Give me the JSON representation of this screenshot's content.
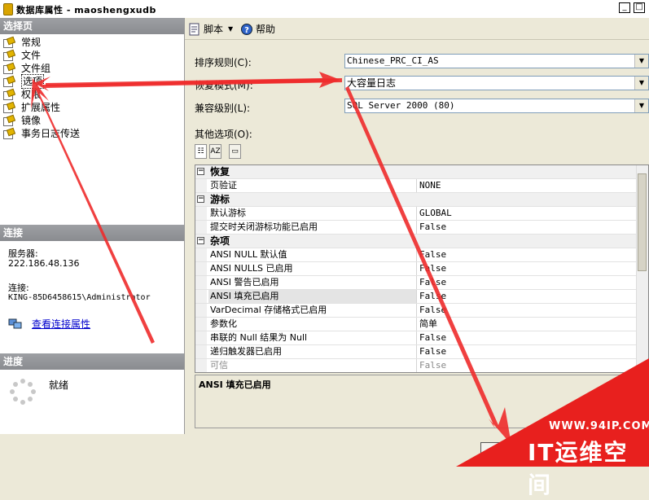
{
  "window": {
    "title": "数据库属性 - maoshengxudb"
  },
  "left": {
    "select_page_header": "选择页",
    "nav_items": [
      "常规",
      "文件",
      "文件组",
      "选项",
      "权限",
      "扩展属性",
      "镜像",
      "事务日志传送"
    ],
    "selected_index": 3,
    "connection_header": "连接",
    "server_label": "服务器:",
    "server_value": "222.186.48.136",
    "connection_label": "连接:",
    "connection_value": "KING-85D6458615\\Administrator",
    "view_conn_link": "查看连接属性",
    "progress_header": "进度",
    "progress_status": "就绪"
  },
  "toolbar": {
    "script_label": "脚本",
    "help_label": "帮助"
  },
  "form": {
    "collation_label": "排序规则(C):",
    "collation_value": "Chinese_PRC_CI_AS",
    "recovery_label": "恢复模式(M):",
    "recovery_value": "大容量日志",
    "compat_label": "兼容级别(L):",
    "compat_value": "SQL Server 2000 (80)",
    "other_options_label": "其他选项(O):"
  },
  "grid": {
    "rows": [
      {
        "type": "cat",
        "name": "恢复"
      },
      {
        "name": "页验证",
        "value": "NONE"
      },
      {
        "type": "cat",
        "name": "游标"
      },
      {
        "name": "默认游标",
        "value": "GLOBAL"
      },
      {
        "name": "提交时关闭游标功能已启用",
        "value": "False"
      },
      {
        "type": "cat",
        "name": "杂项"
      },
      {
        "name": "ANSI NULL 默认值",
        "value": "False"
      },
      {
        "name": "ANSI NULLS 已启用",
        "value": "False"
      },
      {
        "name": "ANSI 警告已启用",
        "value": "False"
      },
      {
        "name": "ANSI 填充已启用",
        "value": "False",
        "highlight": true
      },
      {
        "name": "VarDecimal 存储格式已启用",
        "value": "False"
      },
      {
        "name": "参数化",
        "value": "简单",
        "cn": true
      },
      {
        "name": "串联的 Null 结果为 Null",
        "value": "False"
      },
      {
        "name": "递归触发器已启用",
        "value": "False"
      },
      {
        "name": "可信",
        "value": "False",
        "dim": true
      }
    ]
  },
  "description": {
    "title": "ANSI 填充已启用"
  },
  "watermark": {
    "site": "WWW.94IP.COM",
    "brand": "IT运维空间"
  },
  "colors": {
    "arrow": "#ee2b2b",
    "section_header": "#9ea0a4",
    "link": "#0000cc"
  }
}
